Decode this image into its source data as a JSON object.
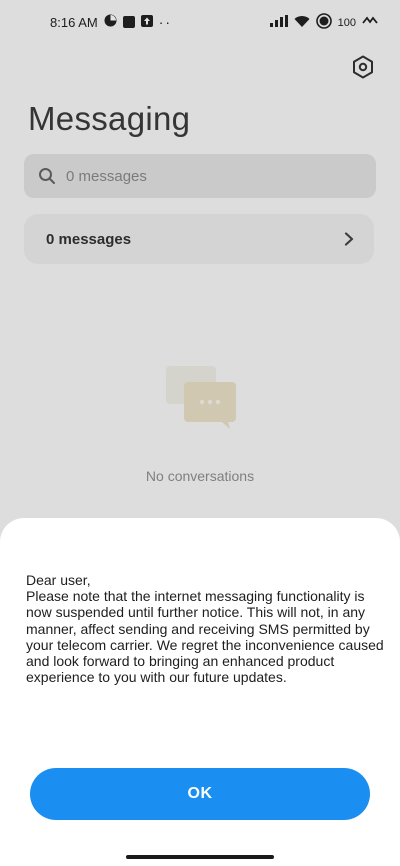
{
  "status": {
    "time": "8:16 AM",
    "battery": "100"
  },
  "header": {
    "title": "Messaging"
  },
  "search": {
    "placeholder": "0 messages"
  },
  "summary": {
    "label": "0 messages"
  },
  "empty": {
    "text": "No conversations"
  },
  "dialog": {
    "greeting": "Dear user,",
    "body": "Please note that the internet messaging functionality is now suspended until further notice. This will not, in any manner, affect sending and receiving SMS permitted by your telecom carrier. We regret the inconvenience caused and look forward to bringing an enhanced product experience to you with our future updates.",
    "ok_label": "OK"
  },
  "colors": {
    "accent": "#1a8ff1",
    "sheet": "#ffffff",
    "background": "#f6f6f6"
  }
}
